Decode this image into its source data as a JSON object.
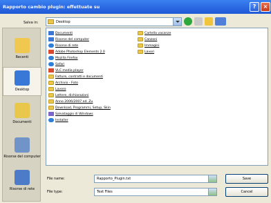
{
  "window": {
    "title": "Rapporto cambio plugin: effettuate su",
    "help_glyph": "?",
    "close_glyph": "×"
  },
  "lookin": {
    "label": "Salva in:",
    "value": "Desktop"
  },
  "toolbar": {
    "icons": [
      "back-icon",
      "up-folder-icon",
      "new-folder-icon",
      "views-icon"
    ]
  },
  "places": [
    {
      "label": "Recenti"
    },
    {
      "label": "Desktop"
    },
    {
      "label": "Documenti"
    },
    {
      "label": "Risorse del computer"
    },
    {
      "label": "Risorse di rete"
    }
  ],
  "files": [
    {
      "name": "Documenti",
      "icon": "doc"
    },
    {
      "name": "Risorse del computer",
      "icon": "doc"
    },
    {
      "name": "Risorse di rete",
      "icon": "web"
    },
    {
      "name": "Adobe Photoshop Elements 2.0",
      "icon": "app"
    },
    {
      "name": "Mozilla Firefox",
      "icon": "web"
    },
    {
      "name": "Safari",
      "icon": "web"
    },
    {
      "name": "VLC media player",
      "icon": "app"
    },
    {
      "name": "Fatture, contratti e documenti",
      "icon": "folder"
    },
    {
      "name": "Archivio - Foto",
      "icon": "folder"
    },
    {
      "name": "Lavoro",
      "icon": "folder"
    },
    {
      "name": "Lettere, dichiarazioni",
      "icon": "folder"
    },
    {
      "name": "Anno 2006/2007 ed. Zu",
      "icon": "folder"
    },
    {
      "name": "Download, Programmi, Setup, Skin",
      "icon": "folder"
    },
    {
      "name": "Salvataggio di Windows",
      "icon": "sys"
    },
    {
      "name": "Installer",
      "icon": "web"
    },
    {
      "name": "Cartella vacanze",
      "icon": "folder"
    },
    {
      "name": "Canzoni",
      "icon": "folder"
    },
    {
      "name": "Immagini",
      "icon": "folder"
    },
    {
      "name": "Lavori",
      "icon": "folder"
    }
  ],
  "filename": {
    "label": "File name:",
    "value": "Rapporto_Plugin.txt"
  },
  "filetype": {
    "label": "File type:",
    "value": "Text Files"
  },
  "buttons": {
    "save": "Save",
    "cancel": "Cancel"
  }
}
